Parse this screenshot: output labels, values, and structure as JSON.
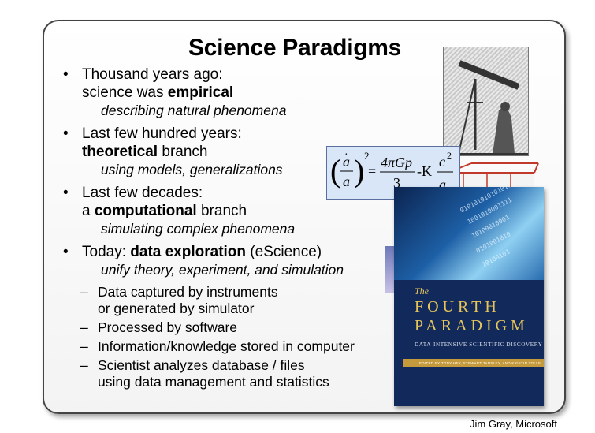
{
  "slide": {
    "title": "Science Paradigms",
    "bullets": [
      {
        "line1": "Thousand years ago:",
        "line2_pre": "science was ",
        "line2_bold": "empirical",
        "line2_post": "",
        "sub": "describing natural phenomena"
      },
      {
        "line1": "Last few hundred years:",
        "line2_pre": "",
        "line2_bold": "theoretical",
        "line2_post": " branch",
        "sub": "using models, generalizations"
      },
      {
        "line1": "Last few decades:",
        "line2_pre": "a ",
        "line2_bold": "computational",
        "line2_post": " branch",
        "sub": "simulating complex phenomena"
      },
      {
        "line1_pre": "Today: ",
        "line1_bold": "data exploration",
        "line1_post": " (eScience)",
        "sub": "unify theory, experiment, and simulation"
      }
    ],
    "dashes": [
      {
        "line1": "Data captured by instruments",
        "line2": "or generated by simulator"
      },
      {
        "line1": "Processed by software",
        "line2": ""
      },
      {
        "line1": "Information/knowledge stored in computer",
        "line2": ""
      },
      {
        "line1": "Scientist analyzes database / files",
        "line2": "using data management and statistics"
      }
    ],
    "bullet_glyph": "•",
    "dash_glyph": "–"
  },
  "equation": {
    "a_dot": "a",
    "exp": "2",
    "rhs_num": "4πGp",
    "rhs_den": "3",
    "minus_k": "-K",
    "c": "c",
    "c_exp": "2",
    "a_den": "a"
  },
  "book": {
    "the": "The",
    "title_line1": "FOURTH",
    "title_line2": "PARADIGM",
    "subtitle": "DATA-INTENSIVE SCIENTIFIC DISCOVERY",
    "editors": "EDITED BY TONY HEY, STEWART TANSLEY, AND KRISTIN TOLLE",
    "binary": [
      "0101010101010101",
      "1001010001111",
      "10100010001",
      "0101001010",
      "10100101"
    ]
  },
  "credit": "Jim Gray, Microsoft",
  "colors": {
    "book_blue": "#122a5b",
    "book_gold": "#e8c55a",
    "equation_bg": "#d9e6f7"
  }
}
